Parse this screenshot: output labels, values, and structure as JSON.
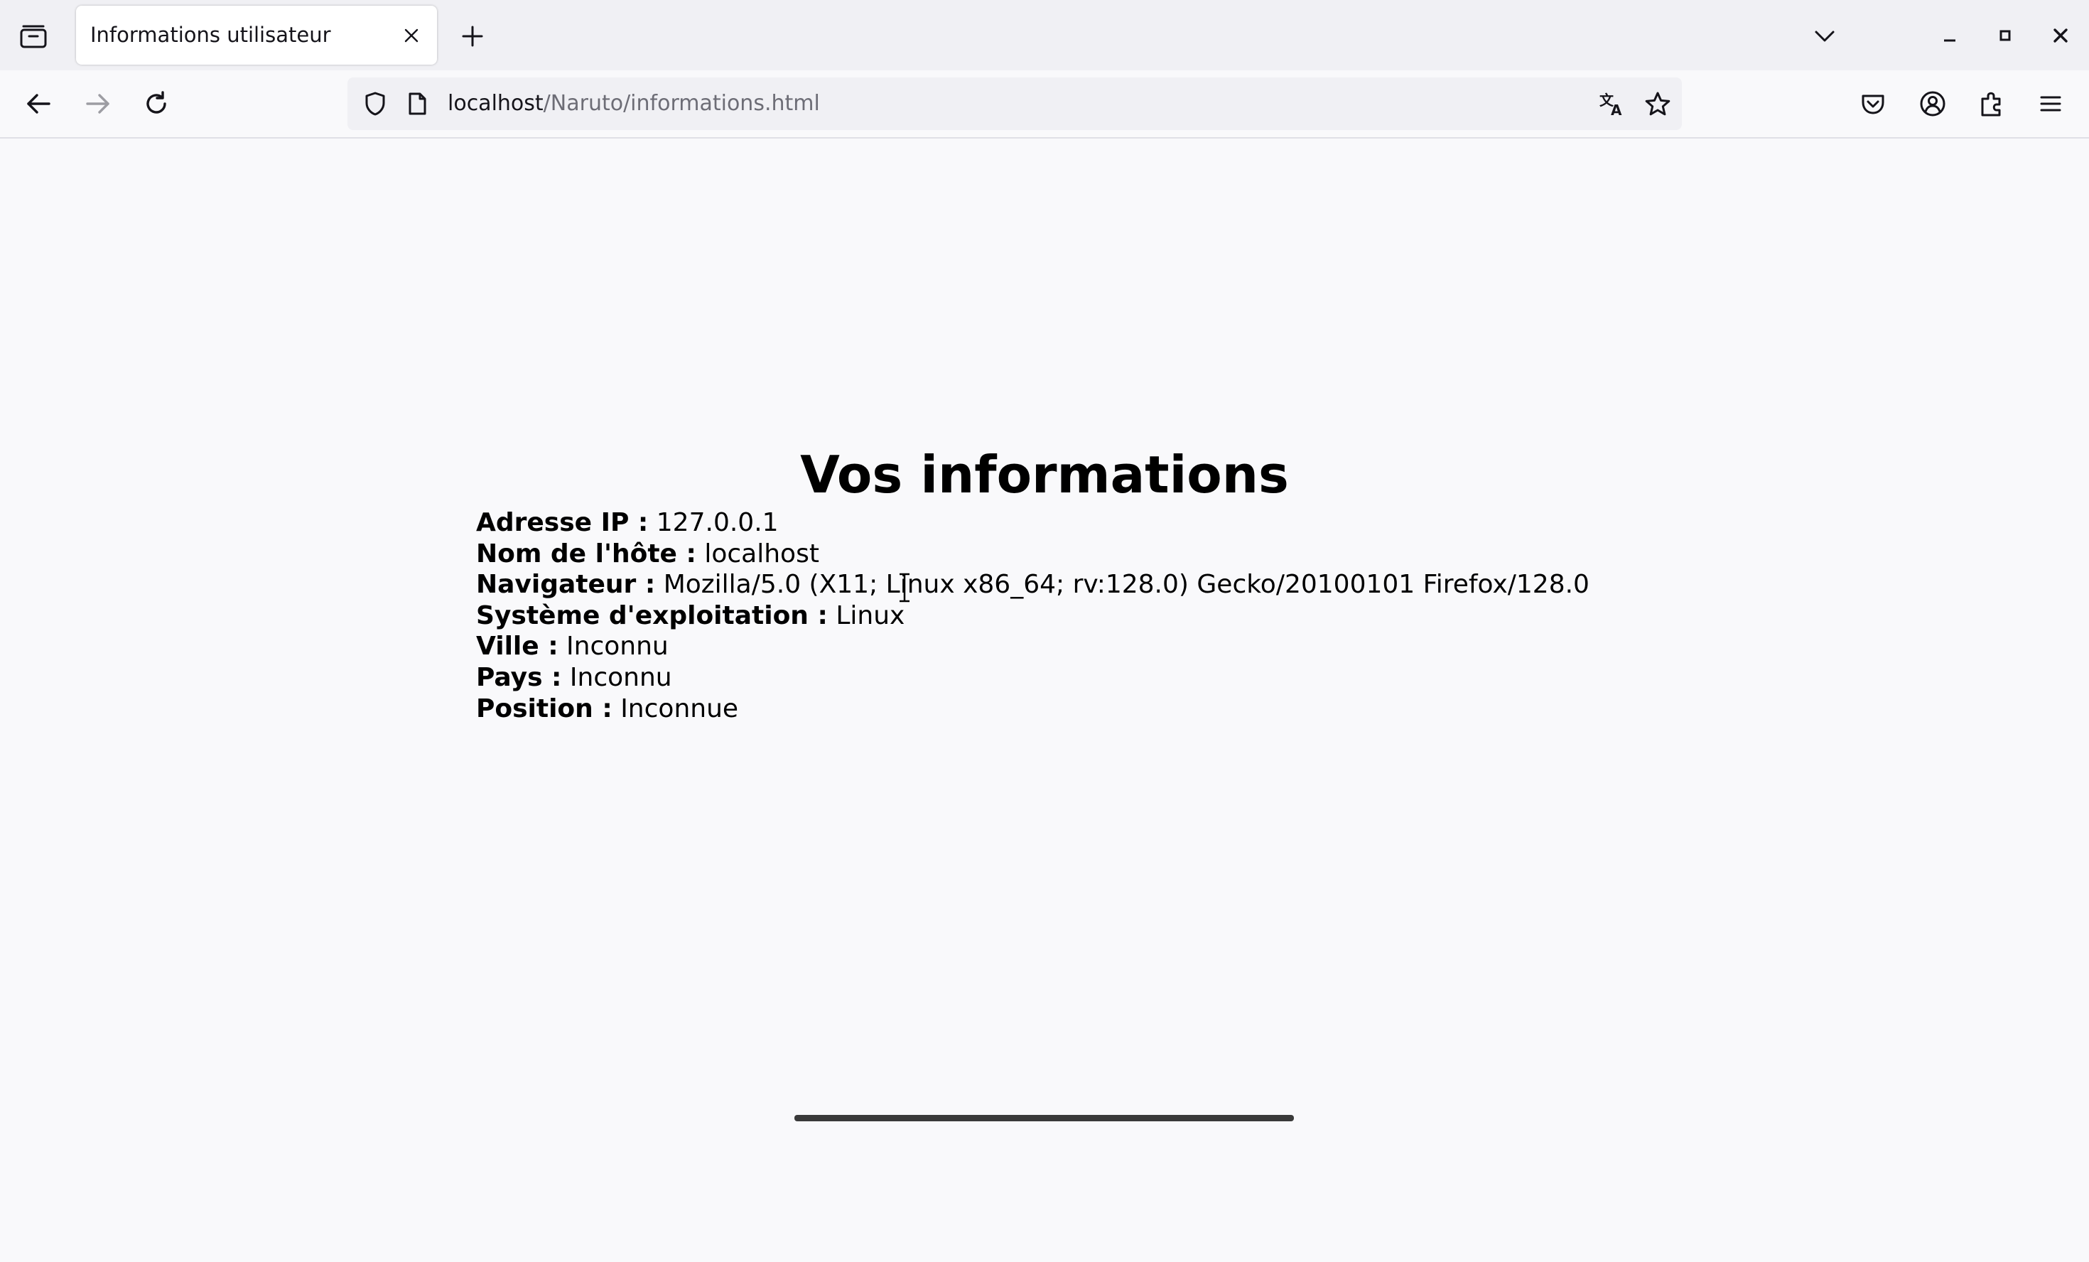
{
  "tab": {
    "title": "Informations utilisateur"
  },
  "urlbar": {
    "host": "localhost",
    "path": "/Naruto/informations.html"
  },
  "page": {
    "heading": "Vos informations",
    "rows": [
      {
        "label": "Adresse IP :",
        "value": "127.0.0.1"
      },
      {
        "label": "Nom de l'hôte :",
        "value": "localhost"
      },
      {
        "label": "Navigateur :",
        "value": "Mozilla/5.0 (X11; Linux x86_64; rv:128.0) Gecko/20100101 Firefox/128.0"
      },
      {
        "label": "Système d'exploitation :",
        "value": "Linux"
      },
      {
        "label": "Ville :",
        "value": "Inconnu"
      },
      {
        "label": "Pays :",
        "value": "Inconnu"
      },
      {
        "label": "Position :",
        "value": "Inconnue"
      }
    ]
  },
  "icons": {
    "tab_list": "tab-list-icon",
    "close_tab": "close-icon",
    "new_tab": "plus-icon",
    "tab_overflow": "chevron-down-icon",
    "minimize": "minimize-icon",
    "maximize": "maximize-icon",
    "close_window": "close-icon",
    "back": "arrow-left-icon",
    "forward": "arrow-right-icon",
    "reload": "reload-icon",
    "tracking_protection": "shield-icon",
    "page_info": "page-icon",
    "translate": "translate-icon",
    "bookmark": "star-icon",
    "pocket": "pocket-icon",
    "account": "account-icon",
    "extensions": "puzzle-icon",
    "menu": "hamburger-menu-icon"
  },
  "colors": {
    "page_background": "#f9f9fb",
    "toolbar_background": "#f0f0f4",
    "text": "#000000",
    "url_path": "#6d6d76"
  }
}
